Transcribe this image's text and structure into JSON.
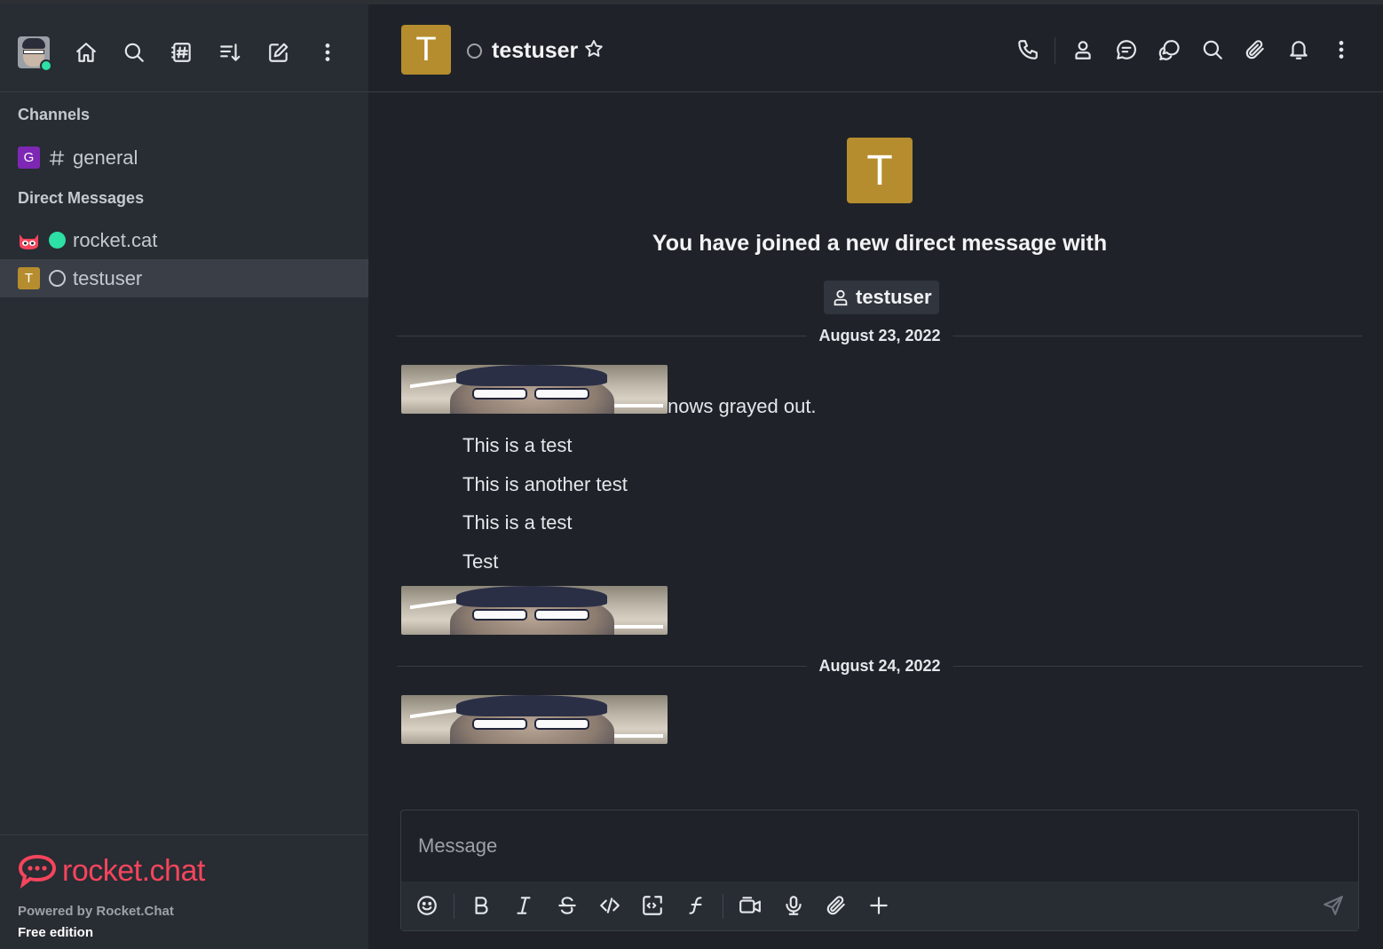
{
  "sidebar": {
    "sections": {
      "channels": "Channels",
      "direct_messages": "Direct Messages"
    },
    "channels": [
      {
        "avatar_letter": "G",
        "avatar_color": "#7d27b4",
        "name": "general"
      }
    ],
    "direct_messages": [
      {
        "name": "rocket.cat",
        "status": "online",
        "status_color": "#2de0a5"
      },
      {
        "avatar_letter": "T",
        "avatar_color": "#b68d2e",
        "name": "testuser",
        "status": "offline",
        "active": true
      }
    ],
    "footer": {
      "logo_text": "rocket.chat",
      "powered_by": "Powered by Rocket.Chat",
      "edition": "Free edition"
    },
    "toolbar_icons": [
      "home-icon",
      "search-icon",
      "directory-icon",
      "sort-icon",
      "create-new-icon",
      "kebab-menu-icon"
    ]
  },
  "header": {
    "avatar_letter": "T",
    "avatar_color": "#b68d2e",
    "room_name": "testuser",
    "status": "offline",
    "toolbar_icons": [
      "call-icon",
      "user-info-icon",
      "discussion-icon",
      "threads-icon",
      "search-messages-icon",
      "files-icon",
      "notifications-icon",
      "kebab-menu-icon"
    ]
  },
  "room_intro": {
    "avatar_letter": "T",
    "text": "You have joined a new direct message with",
    "user_chip": "testuser"
  },
  "messages": {
    "day1": "August 23, 2022",
    "partial_text": "nows grayed out.",
    "texts": [
      "This is a test",
      "This is another test",
      "This is a test",
      "Test"
    ],
    "day2": "August 24, 2022"
  },
  "composer": {
    "placeholder": "Message",
    "toolbar_icons": [
      "emoji-icon",
      "bold-icon",
      "italic-icon",
      "strikethrough-icon",
      "inline-code-icon",
      "code-block-icon",
      "formula-icon",
      "video-message-icon",
      "audio-message-icon",
      "attachment-icon",
      "plus-icon",
      "send-icon"
    ]
  },
  "colors": {
    "accent": "#f5455c",
    "online": "#2de0a5",
    "background": "#1f2329",
    "sidebar": "#282c33"
  }
}
